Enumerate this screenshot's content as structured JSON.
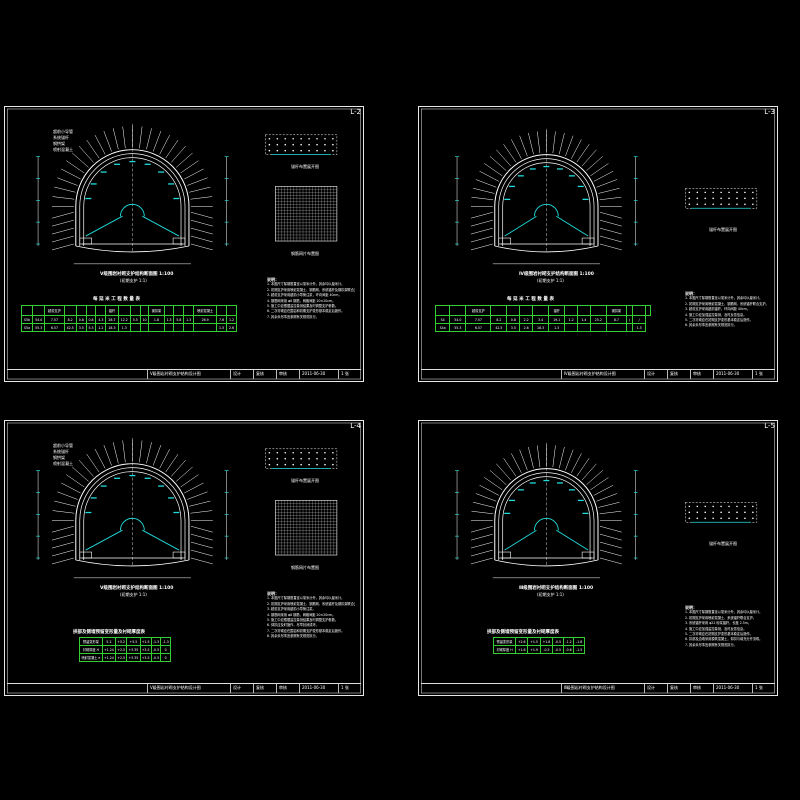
{
  "sheets": [
    {
      "id": "top-left",
      "sheet_no": "L-2",
      "has_mesh": true,
      "table_type": "big",
      "labels": {
        "section_caption": "Ⅴ级围岩衬砌支护结构断面图 1:100",
        "section_sub": "(初期支护 1:1)",
        "mesh_caption": "钢筋网片布置图",
        "detail_caption": "锚杆布置展开图",
        "table_title": "每 延 米 工 程 数 量 表",
        "legend": [
          "超前小导管",
          "系统锚杆",
          "钢拱架",
          "喷射混凝土"
        ],
        "note_heading": "说明：",
        "notes": [
          "1. 本图尺寸除钢筋直径以毫米计外，其余均以厘米计。",
          "2. 初期支护采用喷射混凝土、钢筋网、系统锚杆及钢拱架联合支护。",
          "3. 超前支护采用超前小导管注浆，环向间距 40cm。",
          "4. 钢筋网采用 φ8 钢筋，网格间距 20×20cm。",
          "5. 施工中应根据监控量测结果及时调整支护参数。",
          "6. 二次衬砌应在围岩和初期支护变形基本稳定后施作。",
          "7. 其余未尽事宜参照有关规范执行。"
        ]
      },
      "table_rows": [
        [
          "",
          "",
          "超前支护",
          "",
          "",
          "",
          "",
          "锚杆",
          "",
          "",
          "",
          "钢拱架",
          "",
          "",
          "",
          "喷射混凝土",
          "",
          ""
        ],
        [
          "S5b",
          "54.0",
          "7.57",
          "8.2",
          "0.8",
          "0.8",
          "4.3",
          "28.7",
          "12.2",
          "5.5",
          "10",
          "1.8",
          "1.3",
          "5.8",
          "1.3",
          "26.9",
          "7.6",
          "1.2"
        ],
        [
          "S5a",
          "55.3",
          "6.57",
          "42.5",
          "3.5",
          "5.3",
          "1.2",
          "18.3",
          "1.3",
          "",
          "",
          "",
          "",
          "",
          "",
          "",
          "1.5",
          "2.6"
        ]
      ],
      "title_block": {
        "title": "Ⅴ级围岩衬砌支护结构设计图",
        "f1": "设计",
        "f2": "复核",
        "f3": "审核",
        "date": "2011-06-30",
        "page": "1 张"
      }
    },
    {
      "id": "top-right",
      "sheet_no": "L-3",
      "has_mesh": false,
      "table_type": "big",
      "labels": {
        "section_caption": "Ⅳ级围岩衬砌支护结构断面图 1:100",
        "section_sub": "(初期支护 1:1)",
        "mesh_caption": "",
        "detail_caption": "锚杆布置展开图",
        "table_title": "每 延 米 工 程 数 量 表",
        "legend": [],
        "note_heading": "说明：",
        "notes": [
          "1. 本图尺寸除钢筋直径以毫米计外，其余均以厘米计。",
          "2. 初期支护采用喷射混凝土、钢筋网、系统锚杆联合支护。",
          "3. 超前支护采用超前锚杆，环向间距 40cm。",
          "4. 施工中应加强监控量测，及时反馈信息。",
          "5. 二次衬砌应在初期支护变形基本稳定后施作。",
          "6. 其余未尽事宜参照有关规范执行。"
        ]
      },
      "table_rows": [
        [
          "",
          "",
          "超前支护",
          "",
          "",
          "",
          "",
          "锚杆",
          "",
          "",
          "",
          "钢拱架",
          "",
          "",
          ""
        ],
        [
          "S4",
          "54.0",
          "7.57",
          "8.2",
          "0.8",
          "2.2",
          "3.4",
          "19.1",
          "1.2",
          "1.4",
          "25.2",
          "8.7",
          "/",
          "/"
        ],
        [
          "S4a",
          "55.3",
          "6.57",
          "42.5",
          "3.5",
          "2.6",
          "18.3",
          "1.3",
          "",
          "",
          "",
          "",
          "",
          "1.5"
        ]
      ],
      "title_block": {
        "title": "Ⅳ级围岩衬砌支护结构设计图",
        "f1": "设计",
        "f2": "复核",
        "f3": "审核",
        "date": "2011-06-30",
        "page": "1 张"
      }
    },
    {
      "id": "bottom-left",
      "sheet_no": "L-4",
      "has_mesh": true,
      "table_type": "small",
      "labels": {
        "section_caption": "Ⅴ级围岩衬砌支护结构断面图 1:100",
        "section_sub": "(初期支护 1:1)",
        "mesh_caption": "钢筋网片布置图",
        "detail_caption": "锚杆布置展开图",
        "table_title": "拱部及侧墙预留变形量及衬砌厚度表",
        "legend": [
          "超前小导管",
          "系统锚杆",
          "钢拱架",
          "喷射混凝土"
        ],
        "note_heading": "说明：",
        "notes": [
          "1. 本图尺寸除钢筋直径以毫米计外，其余均以厘米计。",
          "2. 初期支护采用喷射混凝土、钢筋网、系统锚杆及钢拱架联合支护。",
          "3. 超前支护采用超前小导管注浆。",
          "4. 钢筋网采用 φ8 钢筋，网格间距 20×20cm。",
          "5. 施工中应根据监控量测结果及时调整支护参数。",
          "6. 仰拱应及时施作，尽早封闭成环。",
          "7. 二次衬砌应在围岩和初期支护变形基本稳定后施作。",
          "8. 其余未尽事宜参照有关规范执行。"
        ]
      },
      "table_rows": [
        [
          "预留变形量",
          "5.2",
          "+5.2",
          "+5.5",
          "+1.5",
          "-1.3",
          "-1.3"
        ],
        [
          "衬砌厚度 H",
          "+1.24",
          "+2.5",
          "+3.35",
          "+3.5",
          "-0.5",
          "0"
        ],
        [
          "喷射混凝土 e",
          "+1.24",
          "+2.5",
          "+3.35",
          "+3.5",
          "-0.5",
          "0"
        ]
      ],
      "title_block": {
        "title": "Ⅴ级围岩衬砌支护结构设计图",
        "f1": "设计",
        "f2": "复核",
        "f3": "审核",
        "date": "2011-06-30",
        "page": "1 张"
      }
    },
    {
      "id": "bottom-right",
      "sheet_no": "L-5",
      "has_mesh": false,
      "table_type": "small",
      "labels": {
        "section_caption": "Ⅲ级围岩衬砌支护结构断面图 1:100",
        "section_sub": "(初期支护 1:1)",
        "mesh_caption": "",
        "detail_caption": "锚杆布置展开图",
        "table_title": "拱部及侧墙预留变形量及衬砌厚度表",
        "legend": [],
        "note_heading": "说明：",
        "notes": [
          "1. 本图尺寸除钢筋直径以毫米计外，其余均以厘米计。",
          "2. 初期支护采用喷射混凝土、系统锚杆联合支护。",
          "3. 系统锚杆采用 φ22 砂浆锚杆，长度 2.5m。",
          "4. 施工中应加强监控量测，及时反馈信息。",
          "5. 二次衬砌应在初期支护变形基本稳定后施作。",
          "6. 拱部及边墙采用模筑混凝土，仰拱与填充分开浇筑。",
          "7. 其余未尽事宜参照有关规范执行。"
        ]
      },
      "table_rows": [
        [
          "预留变形量",
          "+2.6",
          "+1.5",
          "+1.8",
          "-0.5",
          "-1.2",
          "-1.8"
        ],
        [
          "衬砌厚度 H",
          "+1.6",
          "+1.9",
          "-0.5",
          "-0.5",
          "-0.6",
          "-1.5"
        ]
      ],
      "title_block": {
        "title": "Ⅲ级围岩衬砌支护结构设计图",
        "f1": "设计",
        "f2": "复核",
        "f3": "审核",
        "date": "2011-06-30",
        "page": "1 张"
      }
    }
  ]
}
